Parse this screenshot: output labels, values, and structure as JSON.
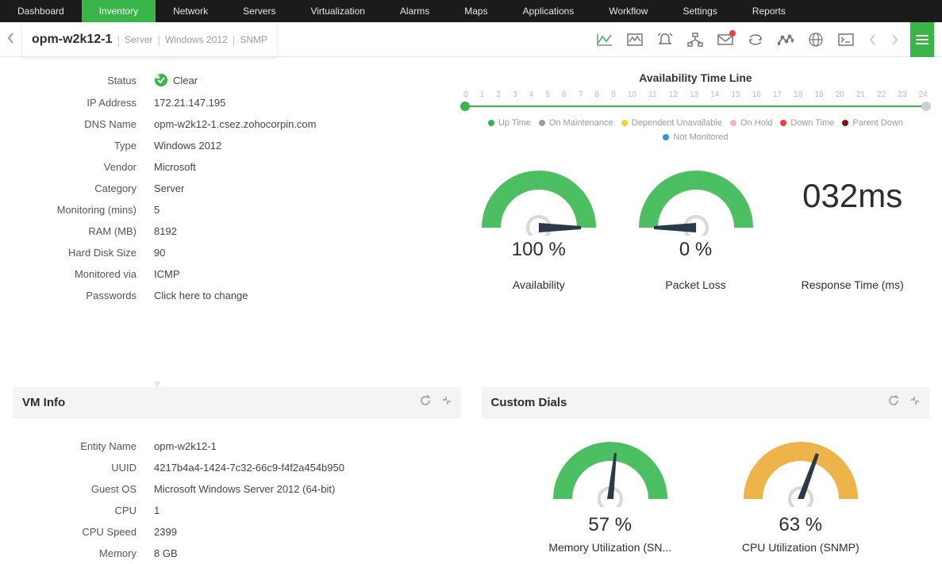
{
  "nav": [
    "Dashboard",
    "Inventory",
    "Network",
    "Servers",
    "Virtualization",
    "Alarms",
    "Maps",
    "Applications",
    "Workflow",
    "Settings",
    "Reports"
  ],
  "nav_active": 1,
  "crumb": {
    "name": "opm-w2k12-1",
    "kind": "Server",
    "os": "Windows 2012",
    "proto": "SNMP"
  },
  "details": {
    "status_label": "Status",
    "status_value": "Clear",
    "ip_label": "IP Address",
    "ip_value": "172.21.147.195",
    "dns_label": "DNS Name",
    "dns_value": "opm-w2k12-1.csez.zohocorpin.com",
    "type_label": "Type",
    "type_value": "Windows 2012",
    "vendor_label": "Vendor",
    "vendor_value": "Microsoft",
    "cat_label": "Category",
    "cat_value": "Server",
    "mon_label": "Monitoring  (mins)",
    "mon_value": "5",
    "ram_label": "RAM (MB)",
    "ram_value": "8192",
    "hd_label": "Hard Disk Size",
    "hd_value": "90",
    "via_label": "Monitored via",
    "via_value": "ICMP",
    "pw_label": "Passwords",
    "pw_value": "Click here to change"
  },
  "timeline": {
    "title": "Availability Time Line",
    "ticks": [
      "0",
      "1",
      "2",
      "3",
      "4",
      "5",
      "6",
      "7",
      "8",
      "9",
      "10",
      "11",
      "12",
      "13",
      "14",
      "15",
      "16",
      "17",
      "18",
      "19",
      "20",
      "21",
      "22",
      "23",
      "24"
    ],
    "legend": [
      {
        "c": "#39b54a",
        "t": "Up Time"
      },
      {
        "c": "#9e9e9e",
        "t": "On Maintenance"
      },
      {
        "c": "#f8d233",
        "t": "Dependent Unavailable"
      },
      {
        "c": "#f7b2b2",
        "t": "On Hold"
      },
      {
        "c": "#ea4040",
        "t": "Down Time"
      },
      {
        "c": "#7a1616",
        "t": "Parent Down"
      },
      {
        "c": "#3a8de0",
        "t": "Not Monitored"
      }
    ]
  },
  "gauges": {
    "avail_value": "100 %",
    "avail_label": "Availability",
    "loss_value": "0 %",
    "loss_label": "Packet Loss",
    "rt_value": "032ms",
    "rt_label": "Response Time (ms)"
  },
  "vm": {
    "title": "VM Info",
    "entity_label": "Entity Name",
    "entity_value": "opm-w2k12-1",
    "uuid_label": "UUID",
    "uuid_value": "4217b4a4-1424-7c32-66c9-f4f2a454b950",
    "guest_label": "Guest OS",
    "guest_value": "Microsoft Windows Server 2012 (64-bit)",
    "cpu_label": "CPU",
    "cpu_value": "1",
    "spd_label": "CPU Speed",
    "spd_value": "2399",
    "mem_label": "Memory",
    "mem_value": "8 GB"
  },
  "custom": {
    "title": "Custom Dials",
    "mem_value": "57 %",
    "mem_label": "Memory Utilization (SN...",
    "cpu_value": "63 %",
    "cpu_label": "CPU Utilization (SNMP)"
  },
  "chart_data": [
    {
      "type": "gauge",
      "title": "Availability",
      "value": 100,
      "unit": "%",
      "min": 0,
      "max": 100,
      "color": "#4cbf62"
    },
    {
      "type": "gauge",
      "title": "Packet Loss",
      "value": 0,
      "unit": "%",
      "min": 0,
      "max": 100,
      "color": "#4cbf62"
    },
    {
      "type": "number",
      "title": "Response Time (ms)",
      "value": 32,
      "unit": "ms"
    },
    {
      "type": "gauge",
      "title": "Memory Utilization (SNMP)",
      "value": 57,
      "unit": "%",
      "min": 0,
      "max": 100,
      "color": "#4cbf62"
    },
    {
      "type": "gauge",
      "title": "CPU Utilization (SNMP)",
      "value": 63,
      "unit": "%",
      "min": 0,
      "max": 100,
      "color": "#efb34b"
    },
    {
      "type": "timeline",
      "title": "Availability Time Line",
      "range": [
        0,
        24
      ],
      "segments": [
        {
          "from": 0,
          "to": 24,
          "state": "Up Time"
        }
      ],
      "legend": [
        "Up Time",
        "On Maintenance",
        "Dependent Unavailable",
        "On Hold",
        "Down Time",
        "Parent Down",
        "Not Monitored"
      ]
    }
  ]
}
